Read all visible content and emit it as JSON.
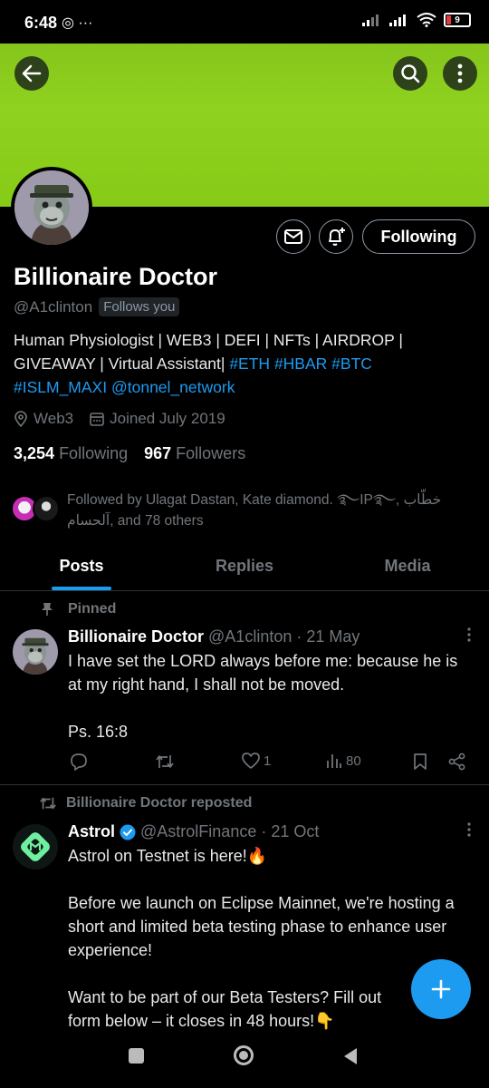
{
  "status_bar": {
    "time": "6:48",
    "left_icons": "◎ ···",
    "battery": "9"
  },
  "profile": {
    "name": "Billionaire Doctor",
    "handle": "@A1clinton",
    "follows_you": "Follows you",
    "bio_text": "Human Physiologist | WEB3 | DEFI | NFTs | AIRDROP | GIVEAWAY | Virtual Assistant|",
    "bio_tags": [
      "#ETH",
      "#HBAR",
      "#BTC",
      "#ISLM_MAXI",
      "@tonnel_network"
    ],
    "location": "Web3",
    "joined": "Joined July 2019",
    "following_count": "3,254",
    "following_label": "Following",
    "followers_count": "967",
    "followers_label": "Followers",
    "followed_by": "Followed by Ulagat Dastan, Kate diamond. ࿐IP࿐, خطّاب آلحسام, and 78 others",
    "following_button": "Following"
  },
  "tabs": [
    "Posts",
    "Replies",
    "Media"
  ],
  "tweets": [
    {
      "label": "Pinned",
      "display_name": "Billionaire Doctor",
      "handle": "@A1clinton",
      "date": "· 21 May",
      "text_line1": "I have set the LORD always before me: because he is at my right hand, I shall not be moved.",
      "text_line2": "Ps. 16:8",
      "likes": "1",
      "views": "80"
    },
    {
      "label": "Billionaire Doctor reposted",
      "display_name": "Astrol",
      "handle": "@AstrolFinance",
      "date": "· 21 Oct",
      "text_p1": "Astrol on Testnet is here!🔥",
      "text_p2": "Before we launch on Eclipse Mainnet, we're hosting a short and limited beta testing phase to enhance user experience!",
      "text_p3": "Want to be part of our Beta Testers? Fill out form below – it closes in 48 hours!👇"
    }
  ],
  "colors": {
    "banner": "#86c51c",
    "accent": "#1d9bf0",
    "background": "#000000"
  }
}
